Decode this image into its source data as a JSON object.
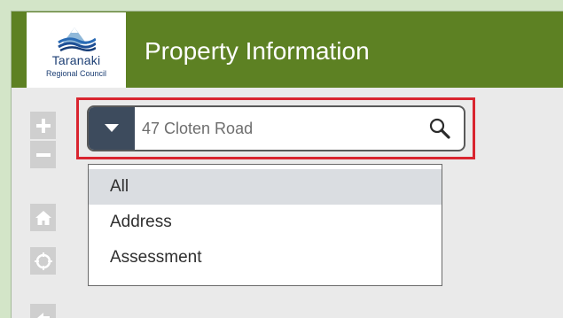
{
  "header": {
    "logo_name": "Taranaki",
    "logo_sub": "Regional Council",
    "title": "Property Information"
  },
  "colors": {
    "header_green": "#5d8123",
    "dropdown_toggle": "#3d4b5d",
    "highlight_red": "#d9252f",
    "selected_item": "#dadde1"
  },
  "map_controls": [
    "zoom-in",
    "zoom-out",
    "home",
    "locate",
    "back"
  ],
  "search": {
    "placeholder": "47 Cloten Road",
    "value": ""
  },
  "dropdown": {
    "items": [
      "All",
      "Address",
      "Assessment"
    ],
    "selected": "All"
  }
}
